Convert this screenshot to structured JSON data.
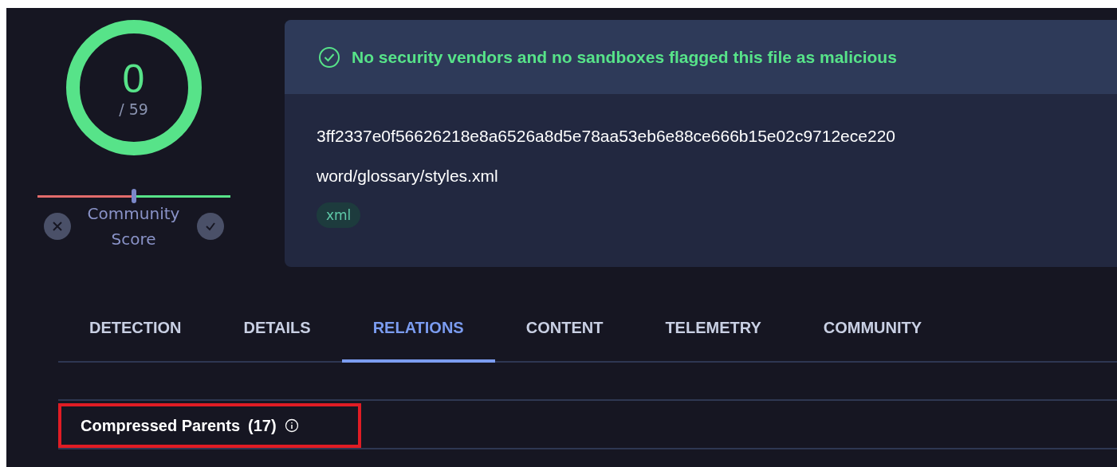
{
  "score": {
    "detections": "0",
    "total": "/ 59"
  },
  "community_score": {
    "label": "Community Score",
    "level": 0.5
  },
  "verdict": {
    "message": "No security vendors and no sandboxes flagged this file as malicious"
  },
  "file": {
    "hash": "3ff2337e0f56626218e8a6526a8d5e78aa53eb6e88ce666b15e02c9712ece220",
    "name": "word/glossary/styles.xml",
    "tags": [
      "xml"
    ]
  },
  "tabs": [
    {
      "label": "DETECTION",
      "selected": false
    },
    {
      "label": "DETAILS",
      "selected": false
    },
    {
      "label": "RELATIONS",
      "selected": true
    },
    {
      "label": "CONTENT",
      "selected": false
    },
    {
      "label": "TELEMETRY",
      "selected": false
    },
    {
      "label": "COMMUNITY",
      "selected": false
    }
  ],
  "section": {
    "title": "Compressed Parents",
    "count": "(17)",
    "highlighted": true
  }
}
